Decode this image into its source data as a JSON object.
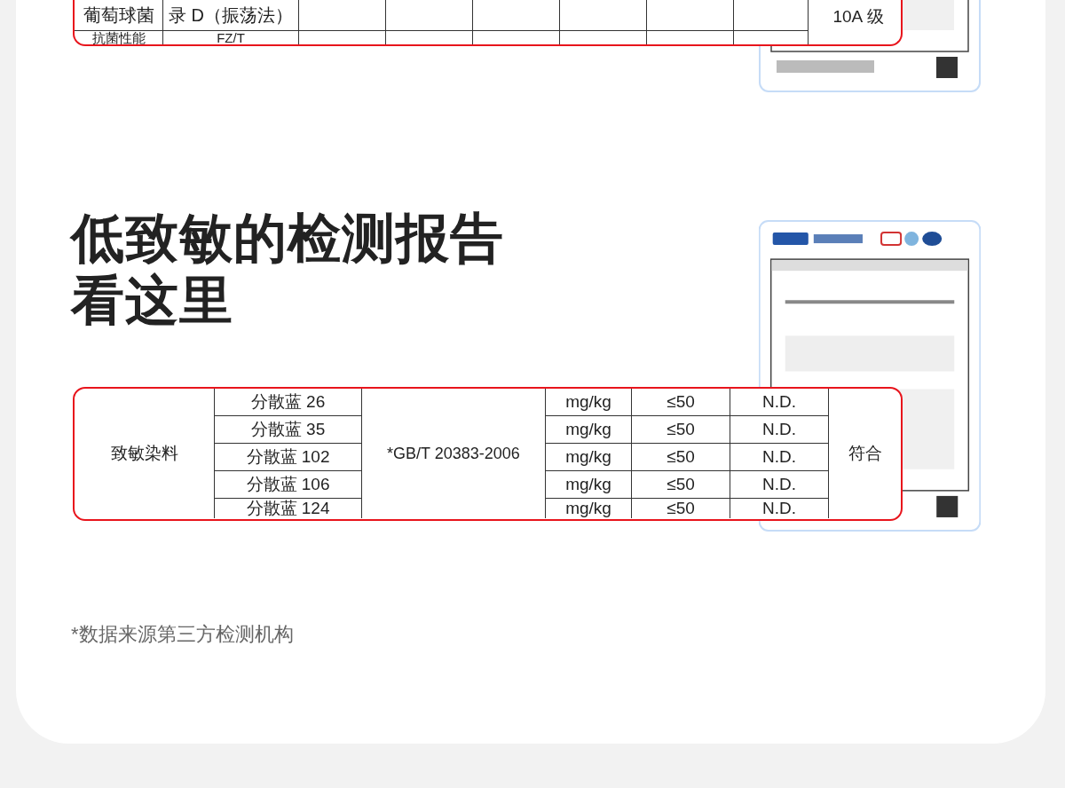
{
  "top_section": {
    "table": {
      "rows": [
        {
          "column_1": "葡萄球菌",
          "column_2": "录 D（振荡法）"
        },
        {
          "column_1": "抗菌性能",
          "column_2": "FZ/T"
        }
      ],
      "column_9": "10A 级"
    }
  },
  "allergen_section": {
    "title_lines": [
      "低致敏的检测报告",
      "看这里"
    ],
    "table": {
      "category": "致敏染料",
      "method": "*GB/T 20383-2006",
      "verdict": "符合",
      "rows": [
        {
          "substance": "分散蓝 26",
          "unit": "mg/kg",
          "limit": "≤50",
          "result": "N.D."
        },
        {
          "substance": "分散蓝 35",
          "unit": "mg/kg",
          "limit": "≤50",
          "result": "N.D."
        },
        {
          "substance": "分散蓝 102",
          "unit": "mg/kg",
          "limit": "≤50",
          "result": "N.D."
        },
        {
          "substance": "分散蓝 106",
          "unit": "mg/kg",
          "limit": "≤50",
          "result": "N.D."
        },
        {
          "substance": "分散蓝 124",
          "unit": "mg/kg",
          "limit": "≤50",
          "result": "N.D."
        }
      ]
    }
  },
  "footnote": "*数据来源第三方检测机构"
}
